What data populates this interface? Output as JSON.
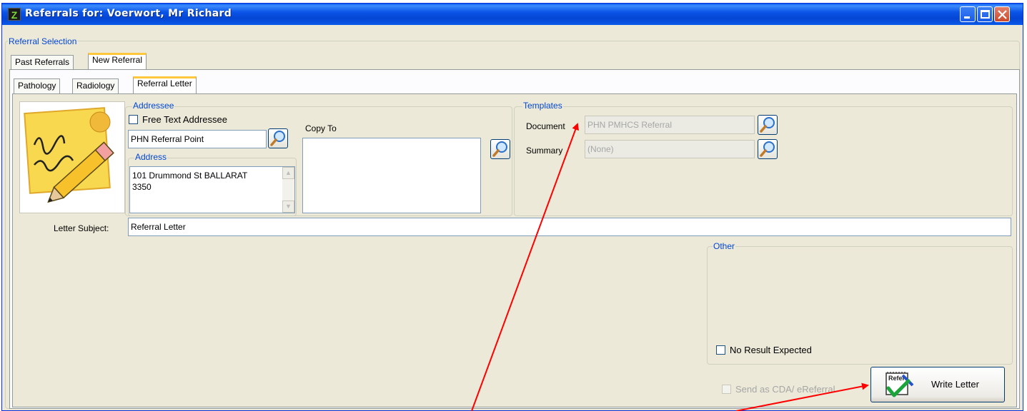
{
  "window": {
    "title": "Referrals for: Voerwort, Mr Richard",
    "app_icon_letter": "Z"
  },
  "referral_selection": {
    "group_label": "Referral Selection",
    "tabs": [
      {
        "label": "Past Referrals",
        "active": false
      },
      {
        "label": "New Referral",
        "active": true
      }
    ],
    "subtabs": [
      {
        "label": "Pathology",
        "active": false
      },
      {
        "label": "Radiology",
        "active": false
      },
      {
        "label": "Referral Letter",
        "active": true
      }
    ]
  },
  "addressee": {
    "group_label": "Addressee",
    "free_text_label": "Free Text Addressee",
    "free_text_checked": false,
    "name_value": "PHN Referral Point",
    "address_label": "Address",
    "address_line1": "101 Drummond St BALLARAT",
    "address_line2": "3350"
  },
  "copy_to": {
    "label": "Copy To"
  },
  "templates": {
    "group_label": "Templates",
    "document_label": "Document",
    "document_value": "PHN PMHCS Referral",
    "summary_label": "Summary",
    "summary_value": "(None)"
  },
  "letter_subject": {
    "label": "Letter Subject:",
    "value": "Referral Letter"
  },
  "other": {
    "group_label": "Other",
    "no_result_label": "No Result Expected",
    "no_result_checked": false
  },
  "footer": {
    "send_cda_label": "Send as CDA/ eReferral",
    "send_cda_enabled": false,
    "write_letter_label": "Write Letter",
    "write_letter_icon_caption": "Refer"
  },
  "colors": {
    "titlebar": "#0a54e6",
    "group_label": "#0046d5",
    "annotation_arrow": "#ff0000",
    "active_tab_accent": "#ffc83c"
  },
  "icons": {
    "lookup": "magnifier-icon",
    "letter": "pencil-letter-icon",
    "write_letter": "refer-checkmark-icon"
  }
}
